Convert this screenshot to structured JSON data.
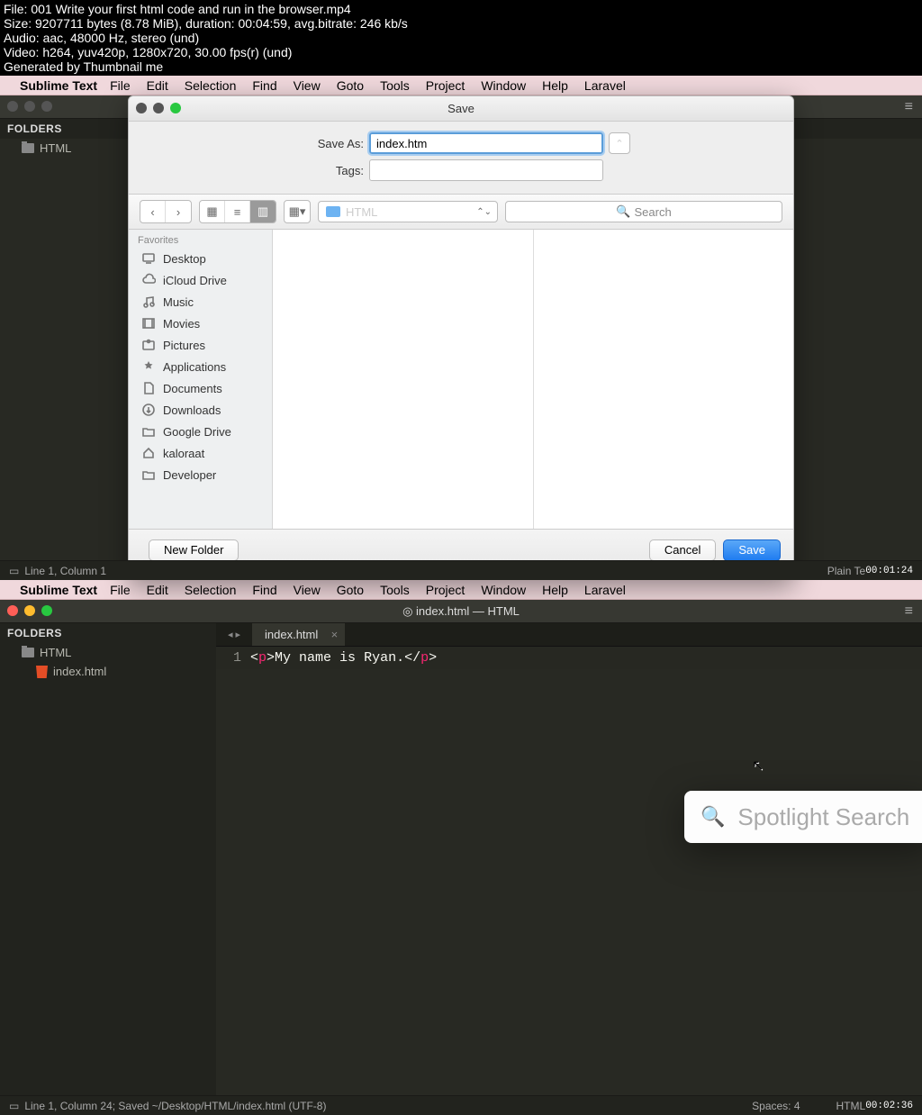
{
  "meta": {
    "file": "File: 001 Write your first html code and run in the browser.mp4",
    "size": "Size: 9207711 bytes (8.78 MiB), duration: 00:04:59, avg.bitrate: 246 kb/s",
    "audio": "Audio: aac, 48000 Hz, stereo (und)",
    "video": "Video: h264, yuv420p, 1280x720, 30.00 fps(r) (und)",
    "gen": "Generated by Thumbnail me"
  },
  "menubar": {
    "app": "Sublime Text",
    "items": [
      "File",
      "Edit",
      "Selection",
      "Find",
      "View",
      "Goto",
      "Tools",
      "Project",
      "Window",
      "Help",
      "Laravel"
    ]
  },
  "top": {
    "folders_label": "FOLDERS",
    "folder_name": "HTML",
    "status_left": "Line 1, Column 1",
    "status_right": "Plain Te",
    "timestamp": "00:01:24"
  },
  "save_dialog": {
    "title": "Save",
    "save_as_label": "Save As:",
    "save_as_value": "index.htm",
    "tags_label": "Tags:",
    "tags_value": "",
    "location": "HTML",
    "search_placeholder": "Search",
    "favorites_label": "Favorites",
    "favorites": [
      "Desktop",
      "iCloud Drive",
      "Music",
      "Movies",
      "Pictures",
      "Applications",
      "Documents",
      "Downloads",
      "Google Drive",
      "kaloraat",
      "Developer"
    ],
    "new_folder": "New Folder",
    "cancel": "Cancel",
    "save": "Save"
  },
  "bottom": {
    "folders_label": "FOLDERS",
    "folder_name": "HTML",
    "file_name": "index.html",
    "window_title": "index.html — HTML",
    "tab_name": "index.html",
    "line_number": "1",
    "code_text": "My name is Ryan.",
    "status_left": "Line 1, Column 24; Saved ~/Desktop/HTML/index.html (UTF-8)",
    "status_spaces": "Spaces: 4",
    "status_lang": "HTML",
    "timestamp": "00:02:36",
    "spotlight_placeholder": "Spotlight Search"
  }
}
